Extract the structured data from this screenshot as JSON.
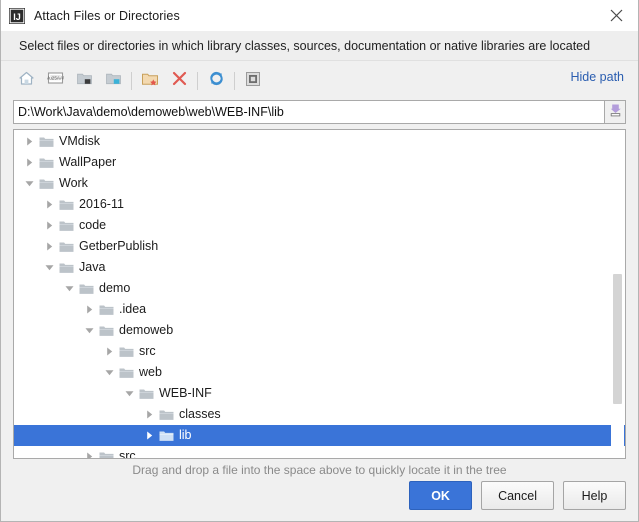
{
  "window": {
    "title": "Attach Files or Directories",
    "app_icon": "intellij-idea-icon",
    "close_label": "✕"
  },
  "subtitle": "Select files or directories in which library classes, sources, documentation or native libraries are located",
  "toolbar": {
    "buttons": [
      {
        "name": "home-icon",
        "tooltip": "Home"
      },
      {
        "name": "desktop-icon",
        "tooltip": "Desktop"
      },
      {
        "name": "project-folder-icon",
        "tooltip": "Project"
      },
      {
        "name": "module-folder-icon",
        "tooltip": "Module"
      },
      {
        "name": "new-folder-icon",
        "tooltip": "New Folder"
      },
      {
        "name": "delete-icon",
        "tooltip": "Delete"
      },
      {
        "name": "refresh-icon",
        "tooltip": "Refresh"
      },
      {
        "name": "show-hidden-files-icon",
        "tooltip": "Show Hidden Files"
      }
    ],
    "hide_path_label": "Hide path"
  },
  "path_field": {
    "value": "D:\\Work\\Java\\demo\\demoweb\\web\\WEB-INF\\lib",
    "placeholder": "",
    "browse_icon": "drop-down-browse-icon"
  },
  "tree": {
    "nodes": [
      {
        "label": "VMdisk",
        "depth": 1,
        "state": "collapsed",
        "selected": false
      },
      {
        "label": "WallPaper",
        "depth": 1,
        "state": "collapsed",
        "selected": false
      },
      {
        "label": "Work",
        "depth": 1,
        "state": "expanded",
        "selected": false
      },
      {
        "label": "2016-11",
        "depth": 2,
        "state": "collapsed",
        "selected": false
      },
      {
        "label": "code",
        "depth": 2,
        "state": "collapsed",
        "selected": false
      },
      {
        "label": "GetberPublish",
        "depth": 2,
        "state": "collapsed",
        "selected": false
      },
      {
        "label": "Java",
        "depth": 2,
        "state": "expanded",
        "selected": false
      },
      {
        "label": "demo",
        "depth": 3,
        "state": "expanded",
        "selected": false
      },
      {
        "label": ".idea",
        "depth": 4,
        "state": "collapsed",
        "selected": false
      },
      {
        "label": "demoweb",
        "depth": 4,
        "state": "expanded",
        "selected": false
      },
      {
        "label": "src",
        "depth": 5,
        "state": "collapsed",
        "selected": false
      },
      {
        "label": "web",
        "depth": 5,
        "state": "expanded",
        "selected": false
      },
      {
        "label": "WEB-INF",
        "depth": 6,
        "state": "expanded",
        "selected": false
      },
      {
        "label": "classes",
        "depth": 7,
        "state": "collapsed",
        "selected": false
      },
      {
        "label": "lib",
        "depth": 7,
        "state": "collapsed",
        "selected": true
      },
      {
        "label": "src",
        "depth": 4,
        "state": "collapsed",
        "selected": false
      }
    ]
  },
  "hint": "Drag and drop a file into the space above to quickly locate it in the tree",
  "buttons": {
    "ok": "OK",
    "cancel": "Cancel",
    "help": "Help"
  },
  "colors": {
    "selection_blue": "#3a74d8",
    "link_blue": "#2a5db0",
    "folder_gray": "#bcc3c9",
    "delete_red": "#e05a52",
    "refresh_blue": "#3d8fd1"
  }
}
